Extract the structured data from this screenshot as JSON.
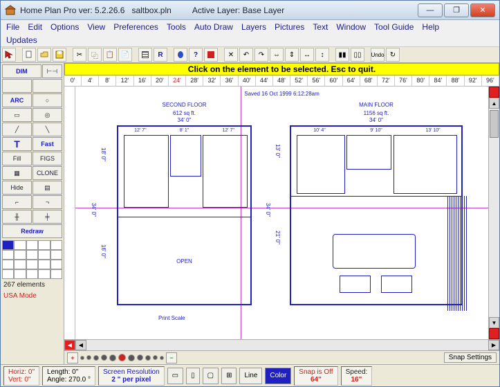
{
  "title": {
    "app": "Home Plan Pro ver: 5.2.26.6",
    "file": "saltbox.pln",
    "layer_label": "Active Layer: Base Layer"
  },
  "menu": [
    "File",
    "Edit",
    "Options",
    "View",
    "Preferences",
    "Tools",
    "Auto Draw",
    "Layers",
    "Pictures",
    "Text",
    "Window",
    "Tool Guide",
    "Help"
  ],
  "menu2": [
    "Updates"
  ],
  "notice": "Click on the element to be selected.  Esc to quit.",
  "ruler_ticks": [
    "0'",
    "4'",
    "8'",
    "12'",
    "16'",
    "20'",
    "24'",
    "28'",
    "32'",
    "36'",
    "40'",
    "44'",
    "48'",
    "52'",
    "56'",
    "60'",
    "64'",
    "68'",
    "72'",
    "76'",
    "80'",
    "84'",
    "88'",
    "92'",
    "96'"
  ],
  "sidebar": {
    "dim": "DIM",
    "arc": "ARC",
    "fast": "Fast",
    "fill": "Fill",
    "figs": "FIGS",
    "clone": "CLONE",
    "hide": "Hide",
    "redraw": "Redraw",
    "elements": "267 elements",
    "mode": "USA Mode"
  },
  "plan": {
    "second": {
      "title": "SECOND FLOOR",
      "area": "612 sq ft.",
      "width": "34' 0\"",
      "seg1": "12' 7\"",
      "seg2": "8' 1\"",
      "seg3": "12' 7\"",
      "h1": "18' 0\"",
      "h2": "16' 0\"",
      "htot": "34' 0\"",
      "open": "OPEN"
    },
    "main": {
      "title": "MAIN FLOOR",
      "area": "1156 sq ft.",
      "width": "34' 0\"",
      "seg1": "10' 4\"",
      "seg2": "9' 10\"",
      "seg3": "13' 10\"",
      "h1": "13' 0\"",
      "h2": "21' 0\"",
      "htot": "34' 0\""
    },
    "saved": "Saved 16 Oct 1999  6:12:28am",
    "printscale": "Print Scale"
  },
  "snap_settings": "Snap Settings",
  "status": {
    "horiz": "Horiz: 0\"",
    "vert": "Vert:  0\"",
    "length": "Length:  0\"",
    "angle": "Angle: 270.0 °",
    "res1": "Screen Resolution",
    "res2": "2 \" per pixel",
    "line": "Line",
    "color": "Color",
    "snap1": "Snap is Off",
    "snap2": "64\"",
    "speed1": "Speed:",
    "speed2": "16\""
  }
}
